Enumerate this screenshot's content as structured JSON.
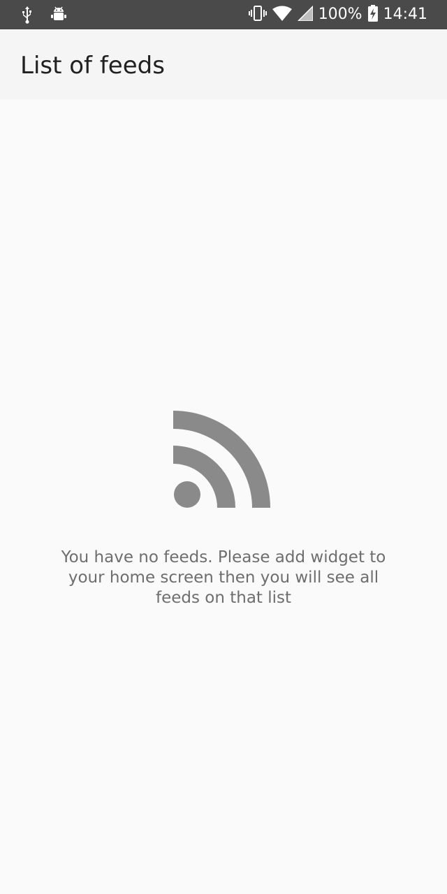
{
  "status_bar": {
    "icons_left": [
      "usb-icon",
      "android-debug-icon"
    ],
    "icons_right": [
      "vibrate-icon",
      "wifi-icon",
      "signal-icon",
      "battery-charging-icon"
    ],
    "battery": "100%",
    "time": "14:41"
  },
  "app_bar": {
    "title": "List of feeds"
  },
  "empty_state": {
    "icon": "rss-feed-icon",
    "icon_color": "#8a8a8a",
    "message": "You have no feeds. Please add widget to your home screen then you will see all feeds on that list"
  }
}
